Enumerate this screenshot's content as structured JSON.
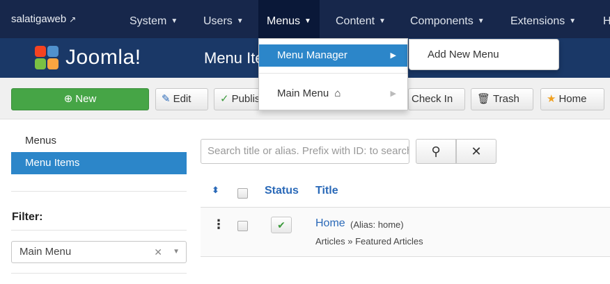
{
  "topnav": {
    "brand": "salatigaweb",
    "brand_icon": "external-link-icon",
    "items": [
      {
        "label": "System"
      },
      {
        "label": "Users"
      },
      {
        "label": "Menus"
      },
      {
        "label": "Content"
      },
      {
        "label": "Components"
      },
      {
        "label": "Extensions"
      },
      {
        "label": "H"
      }
    ],
    "caret": "▼"
  },
  "header": {
    "logo_text": "Joomla!",
    "page_title": "Menu Items"
  },
  "toolbar": {
    "new_label": "New",
    "edit_label": "Edit",
    "publish_label": "Publish",
    "checkin_label": "Check In",
    "trash_label": "Trash",
    "home_label": "Home"
  },
  "sidebar": {
    "items": [
      {
        "label": "Menus"
      },
      {
        "label": "Menu Items"
      }
    ],
    "filter_label": "Filter:",
    "filter_value": "Main Menu"
  },
  "search": {
    "placeholder": "Search title or alias. Prefix with ID: to search for an ID.",
    "search_icon": "magnifier-icon",
    "clear_icon": "close-icon"
  },
  "table": {
    "col_status": "Status",
    "col_title": "Title",
    "rows": [
      {
        "title": "Home",
        "alias": "(Alias: home)",
        "subtitle": "Articles » Featured Articles"
      }
    ]
  },
  "menus_dropdown": {
    "items": [
      {
        "label": "Menu Manager"
      },
      {
        "label": "Main Menu"
      }
    ],
    "submenu": [
      {
        "label": "Add New Menu"
      }
    ]
  },
  "colors": {
    "navbar": "#17274b",
    "header": "#1a3867",
    "accent": "#2c86c9",
    "new_button": "#46a546",
    "link": "#2a69b8"
  }
}
